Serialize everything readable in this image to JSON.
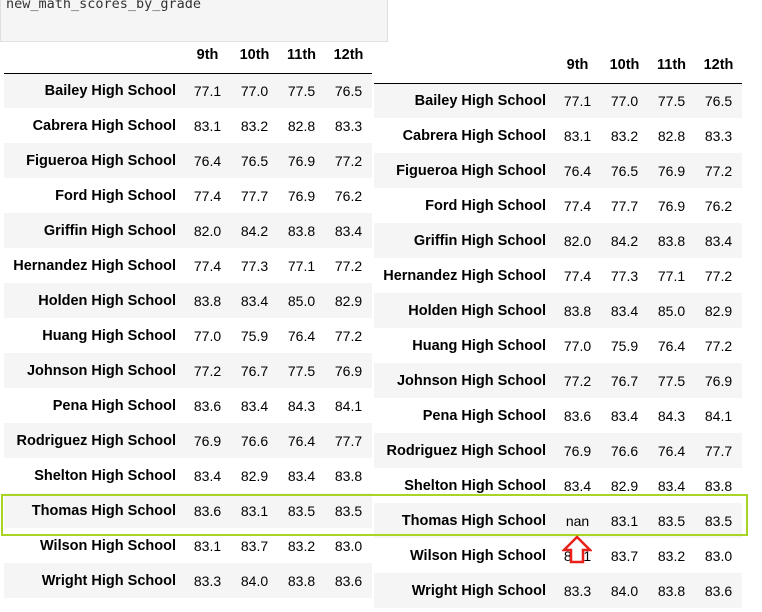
{
  "left": {
    "code_label": "math_scores_by_grade",
    "columns": [
      "9th",
      "10th",
      "11th",
      "12th"
    ],
    "rows": [
      {
        "school": "Bailey High School",
        "values": [
          "77.1",
          "77.0",
          "77.5",
          "76.5"
        ]
      },
      {
        "school": "Cabrera High School",
        "values": [
          "83.1",
          "83.2",
          "82.8",
          "83.3"
        ]
      },
      {
        "school": "Figueroa High School",
        "values": [
          "76.4",
          "76.5",
          "76.9",
          "77.2"
        ]
      },
      {
        "school": "Ford High School",
        "values": [
          "77.4",
          "77.7",
          "76.9",
          "76.2"
        ]
      },
      {
        "school": "Griffin High School",
        "values": [
          "82.0",
          "84.2",
          "83.8",
          "83.4"
        ]
      },
      {
        "school": "Hernandez High School",
        "values": [
          "77.4",
          "77.3",
          "77.1",
          "77.2"
        ]
      },
      {
        "school": "Holden High School",
        "values": [
          "83.8",
          "83.4",
          "85.0",
          "82.9"
        ]
      },
      {
        "school": "Huang High School",
        "values": [
          "77.0",
          "75.9",
          "76.4",
          "77.2"
        ]
      },
      {
        "school": "Johnson High School",
        "values": [
          "77.2",
          "76.7",
          "77.5",
          "76.9"
        ]
      },
      {
        "school": "Pena High School",
        "values": [
          "83.6",
          "83.4",
          "84.3",
          "84.1"
        ]
      },
      {
        "school": "Rodriguez High School",
        "values": [
          "76.9",
          "76.6",
          "76.4",
          "77.7"
        ]
      },
      {
        "school": "Shelton High School",
        "values": [
          "83.4",
          "82.9",
          "83.4",
          "83.8"
        ]
      },
      {
        "school": "Thomas High School",
        "values": [
          "83.6",
          "83.1",
          "83.5",
          "83.5"
        ]
      },
      {
        "school": "Wilson High School",
        "values": [
          "83.1",
          "83.7",
          "83.2",
          "83.0"
        ]
      },
      {
        "school": "Wright High School",
        "values": [
          "83.3",
          "84.0",
          "83.8",
          "83.6"
        ]
      }
    ]
  },
  "right": {
    "code_label": "new_math_scores_by_grade",
    "columns": [
      "9th",
      "10th",
      "11th",
      "12th"
    ],
    "rows": [
      {
        "school": "Bailey High School",
        "values": [
          "77.1",
          "77.0",
          "77.5",
          "76.5"
        ]
      },
      {
        "school": "Cabrera High School",
        "values": [
          "83.1",
          "83.2",
          "82.8",
          "83.3"
        ]
      },
      {
        "school": "Figueroa High School",
        "values": [
          "76.4",
          "76.5",
          "76.9",
          "77.2"
        ]
      },
      {
        "school": "Ford High School",
        "values": [
          "77.4",
          "77.7",
          "76.9",
          "76.2"
        ]
      },
      {
        "school": "Griffin High School",
        "values": [
          "82.0",
          "84.2",
          "83.8",
          "83.4"
        ]
      },
      {
        "school": "Hernandez High School",
        "values": [
          "77.4",
          "77.3",
          "77.1",
          "77.2"
        ]
      },
      {
        "school": "Holden High School",
        "values": [
          "83.8",
          "83.4",
          "85.0",
          "82.9"
        ]
      },
      {
        "school": "Huang High School",
        "values": [
          "77.0",
          "75.9",
          "76.4",
          "77.2"
        ]
      },
      {
        "school": "Johnson High School",
        "values": [
          "77.2",
          "76.7",
          "77.5",
          "76.9"
        ]
      },
      {
        "school": "Pena High School",
        "values": [
          "83.6",
          "83.4",
          "84.3",
          "84.1"
        ]
      },
      {
        "school": "Rodriguez High School",
        "values": [
          "76.9",
          "76.6",
          "76.4",
          "77.7"
        ]
      },
      {
        "school": "Shelton High School",
        "values": [
          "83.4",
          "82.9",
          "83.4",
          "83.8"
        ]
      },
      {
        "school": "Thomas High School",
        "values": [
          "nan",
          "83.1",
          "83.5",
          "83.5"
        ]
      },
      {
        "school": "Wilson High School",
        "values": [
          "83.1",
          "83.7",
          "83.2",
          "83.0"
        ]
      },
      {
        "school": "Wright High School",
        "values": [
          "83.3",
          "84.0",
          "83.8",
          "83.6"
        ]
      }
    ]
  },
  "annotations": {
    "highlight_color": "#a9d424",
    "arrow_color": "#e8201a",
    "arrow_icon": "up-arrow-icon"
  }
}
